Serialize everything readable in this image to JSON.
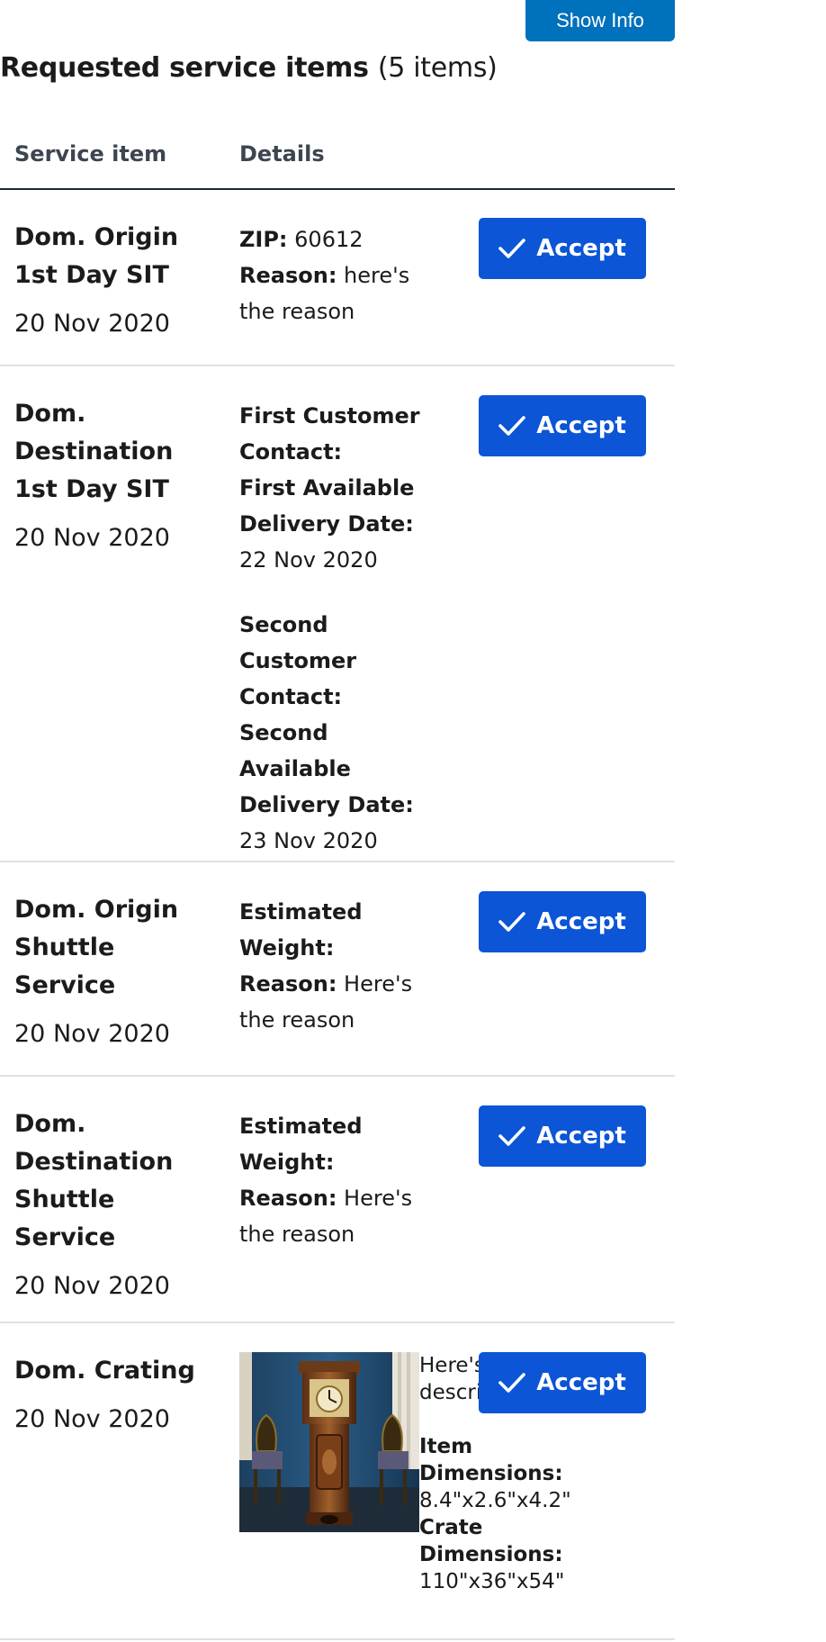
{
  "header": {
    "show_info_label": "Show Info",
    "title": "Requested service items",
    "count": "(5 items)"
  },
  "table": {
    "columns": [
      "Service item",
      "Details"
    ]
  },
  "items": [
    {
      "name": "Dom. Origin 1st Day SIT",
      "date": "20 Nov 2020",
      "details": [
        {
          "label": "ZIP:",
          "value": " 60612"
        },
        {
          "label": "Reason:",
          "value": " here's the reason"
        }
      ],
      "accept_label": "Accept"
    },
    {
      "name": "Dom. Destination 1st Day SIT",
      "date": "20 Nov 2020",
      "details": [
        {
          "label": "First Customer Contact:",
          "value": ""
        },
        {
          "label": "First Available Delivery Date:",
          "value": " 22 Nov 2020"
        },
        {
          "label": "Second Customer Contact:",
          "value": ""
        },
        {
          "label": "Second Available Delivery Date:",
          "value": " 23 Nov 2020"
        }
      ],
      "accept_label": "Accept"
    },
    {
      "name": "Dom. Origin Shuttle Service",
      "date": "20 Nov 2020",
      "details": [
        {
          "label": "Estimated Weight:",
          "value": ""
        },
        {
          "label": "Reason:",
          "value": " Here's the reason"
        }
      ],
      "accept_label": "Accept"
    },
    {
      "name": "Dom. Destination Shuttle Service",
      "date": "20 Nov 2020",
      "details": [
        {
          "label": "Estimated Weight:",
          "value": ""
        },
        {
          "label": "Reason:",
          "value": " Here's the reason"
        }
      ],
      "accept_label": "Accept"
    },
    {
      "name": "Dom. Crating",
      "date": "20 Nov 2020",
      "description": "Here's the description",
      "details": [
        {
          "label": "Item Dimensions:",
          "value": "8.4\"x2.6\"x4.2\""
        },
        {
          "label": "Crate Dimensions:",
          "value": "110\"x36\"x54\""
        }
      ],
      "image_icon": "grandfather-clock-photo",
      "accept_label": "Accept"
    }
  ],
  "colors": {
    "show_info_bg": "#0071bc",
    "accept_bg": "#0b55d6",
    "header_rule": "#1b2940",
    "row_rule": "#dfe1e2"
  }
}
